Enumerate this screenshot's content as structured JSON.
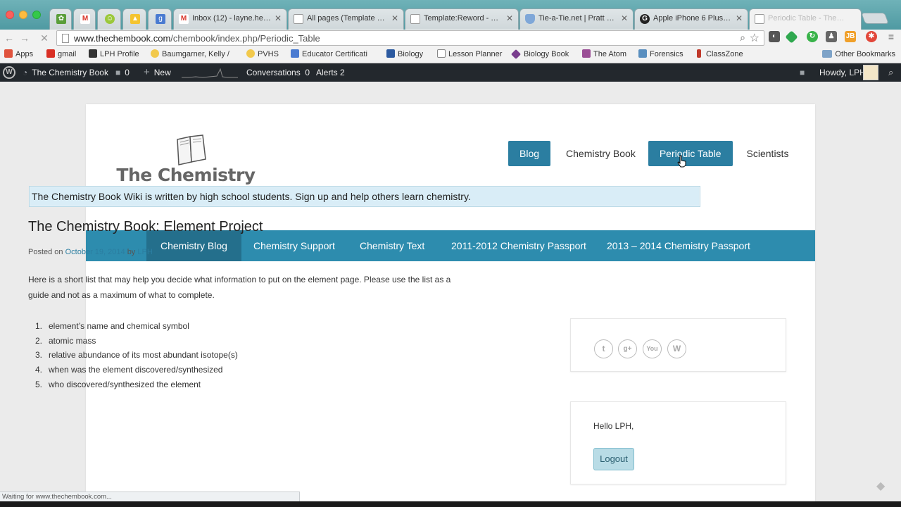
{
  "browser": {
    "tabs": [
      {
        "label": "",
        "icon": "evernote-icon"
      },
      {
        "label": "",
        "icon": "gmail-icon"
      },
      {
        "label": "",
        "icon": "smiley-icon"
      },
      {
        "label": "",
        "icon": "google-drive-icon"
      },
      {
        "label": "",
        "icon": "google-icon"
      },
      {
        "label": "Inbox (12) - layne.heiny@",
        "icon": "gmail-icon"
      },
      {
        "label": "All pages (Template nam",
        "icon": "page-icon"
      },
      {
        "label": "Template:Reword - The ",
        "icon": "page-icon"
      },
      {
        "label": "Tie-a-Tie.net | Pratt Knot",
        "icon": "shield-icon"
      },
      {
        "label": "Apple iPhone 6 Plus Lea",
        "icon": "g-icon"
      },
      {
        "label": "Periodic Table - The Ch",
        "icon": "page-icon"
      }
    ],
    "url_host": "www.thechembook.com",
    "url_path": "/chembook/index.php/Periodic_Table",
    "bookmarks": [
      {
        "label": "Apps",
        "color": "#e0533d"
      },
      {
        "label": "gmail",
        "color": "#d93025"
      },
      {
        "label": "LPH Profile",
        "color": "#333333"
      },
      {
        "label": "Baumgarner, Kelly /",
        "color": "#f2c94c"
      },
      {
        "label": "PVHS",
        "color": "#f2c94c"
      },
      {
        "label": "Educator Certificati",
        "color": "#4a7bd1"
      },
      {
        "label": "Biology",
        "color": "#2c5aa0"
      },
      {
        "label": "Lesson Planner",
        "color": "#777777"
      },
      {
        "label": "Biology Book",
        "color": "#7a3e8e"
      },
      {
        "label": "The Atom",
        "color": "#9b4f96"
      },
      {
        "label": "Forensics",
        "color": "#5a8fbf"
      },
      {
        "label": "ClassZone",
        "color": "#c0392b"
      }
    ],
    "other_bookmarks": "Other Bookmarks",
    "status_text": "Waiting for www.thechembook.com..."
  },
  "adminbar": {
    "site_name": "The Chemistry Book",
    "comments_count": "0",
    "new_label": "New",
    "conversations_label": "Conversations",
    "conversations_count": "0",
    "alerts_label": "Alerts 2",
    "howdy": "Howdy, LPH"
  },
  "site": {
    "logo_text": "The Chemistry Book",
    "main_nav": [
      {
        "label": "Blog",
        "highlight": true
      },
      {
        "label": "Chemistry Book",
        "highlight": false
      },
      {
        "label": "Periodic Table",
        "highlight": true
      },
      {
        "label": "Scientists",
        "highlight": false
      }
    ],
    "sub_nav": [
      {
        "label": "Chemistry Blog",
        "active": true
      },
      {
        "label": "Chemistry Support",
        "active": false
      },
      {
        "label": "Chemistry Text",
        "active": false
      },
      {
        "label": "2011-2012 Chemistry Passport",
        "active": false
      },
      {
        "label": "2013 – 2014 Chemistry Passport",
        "active": false
      }
    ],
    "notice": "The Chemistry Book Wiki is written by high school students. Sign up and help others learn chemistry."
  },
  "post": {
    "title": "The Chemistry Book: Element Project",
    "posted_on": "Posted on",
    "date": "October 19, 2014",
    "by": "by",
    "author": "LPH",
    "intro": "Here is a short list that may help you decide what information to put on the element page. Please use the list as a guide and not as a maximum of what to complete.",
    "list": [
      "element’s name and chemical symbol",
      "atomic mass",
      "relative abundance of its most abundant isotope(s)",
      "when was the element discovered/synthesized",
      "who discovered/synthesized the element"
    ]
  },
  "sidebar": {
    "social_icons": [
      "twitter-icon",
      "google-plus-icon",
      "youtube-icon",
      "wordpress-icon"
    ],
    "hello": "Hello LPH,",
    "logout_label": "Logout"
  }
}
